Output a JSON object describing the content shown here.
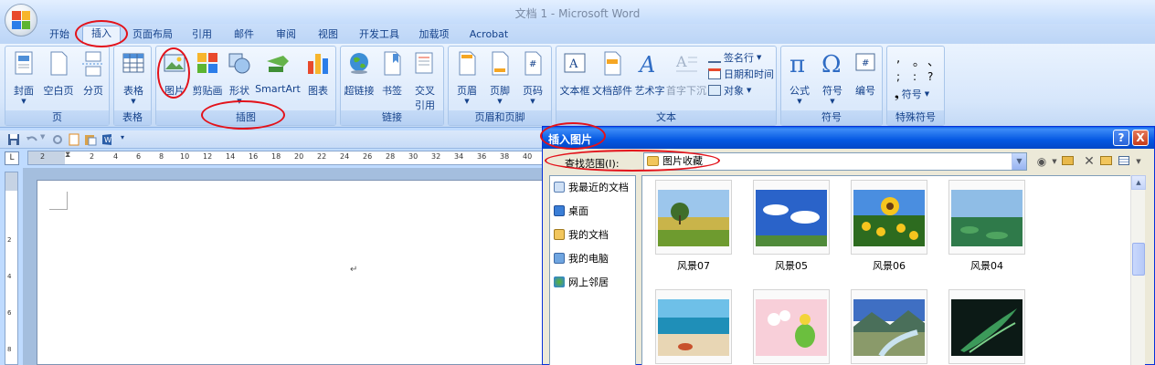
{
  "window": {
    "title": "文档 1 - Microsoft Word"
  },
  "tabs": [
    {
      "label": "开始"
    },
    {
      "label": "插入"
    },
    {
      "label": "页面布局"
    },
    {
      "label": "引用"
    },
    {
      "label": "邮件"
    },
    {
      "label": "审阅"
    },
    {
      "label": "视图"
    },
    {
      "label": "开发工具"
    },
    {
      "label": "加载项"
    },
    {
      "label": "Acrobat"
    }
  ],
  "ribbon": {
    "groups": {
      "pages": {
        "label": "页",
        "buttons": [
          "封面",
          "空白页",
          "分页"
        ]
      },
      "tables": {
        "label": "表格",
        "buttons": [
          "表格"
        ]
      },
      "illustrations": {
        "label": "插图",
        "buttons": [
          "图片",
          "剪贴画",
          "形状",
          "SmartArt",
          "图表"
        ]
      },
      "links": {
        "label": "链接",
        "buttons": [
          "超链接",
          "书签",
          "交叉",
          "引用"
        ]
      },
      "header_footer": {
        "label": "页眉和页脚",
        "buttons": [
          "页眉",
          "页脚",
          "页码"
        ]
      },
      "text": {
        "label": "文本",
        "buttons": [
          "文本框",
          "文档部件",
          "艺术字",
          "首字下沉"
        ],
        "small": [
          "签名行",
          "日期和时间",
          "对象"
        ]
      },
      "symbols": {
        "label": "符号",
        "buttons": [
          "公式",
          "符号",
          "编号"
        ]
      },
      "special": {
        "label": "特殊符号",
        "glyphs": [
          ",",
          "。",
          "、",
          ";",
          ":",
          "?"
        ],
        "more": "符号"
      }
    }
  },
  "ruler": {
    "marks": [
      "2",
      "2",
      "4",
      "6",
      "8",
      "10",
      "12",
      "14",
      "16",
      "18",
      "20",
      "22",
      "24",
      "26",
      "28",
      "30",
      "32",
      "34",
      "36",
      "38",
      "40"
    ],
    "corner": "L"
  },
  "vruler": {
    "marks": [
      "2",
      "4",
      "6",
      "8"
    ]
  },
  "document": {
    "paragraph_mark": "↵"
  },
  "dialog": {
    "title": "插入图片",
    "help": "?",
    "close": "X",
    "look_in_label": "查找范围(I):",
    "look_in_value": "图片收藏",
    "places": [
      "我最近的文档",
      "桌面",
      "我的文档",
      "我的电脑",
      "网上邻居"
    ],
    "files": [
      "风景07",
      "风景05",
      "风景06",
      "风景04",
      "",
      "",
      "",
      ""
    ]
  },
  "colors": {
    "accent": "#15428b",
    "annotation": "#e3121a",
    "dialog_title": "#0558e2"
  }
}
